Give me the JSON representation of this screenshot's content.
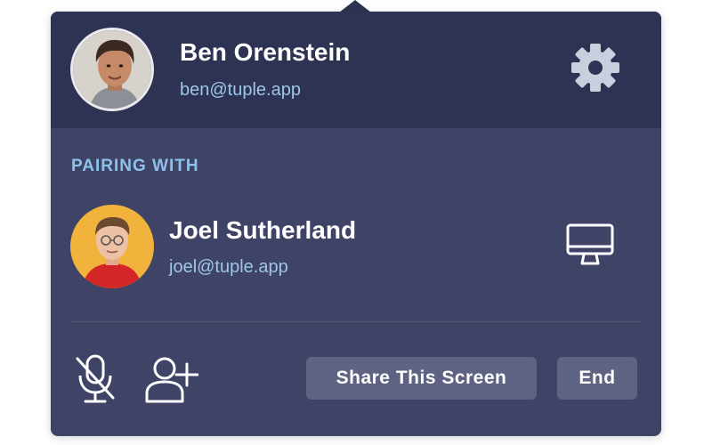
{
  "me": {
    "name": "Ben Orenstein",
    "email": "ben@tuple.app",
    "avatar_icon": "user-photo"
  },
  "settings": {
    "icon": "gear-icon"
  },
  "pairing": {
    "section_label": "PAIRING WITH",
    "peer": {
      "name": "Joel Sutherland",
      "email": "joel@tuple.app",
      "avatar_icon": "user-photo"
    },
    "screen_icon": "monitor-icon"
  },
  "controls": {
    "mic_icon": "microphone-muted-icon",
    "add_user_icon": "add-user-icon",
    "share_label": "Share This Screen",
    "end_label": "End"
  },
  "colors": {
    "header_bg": "#2f3353",
    "panel_bg": "#3f4366",
    "button_bg": "#5f6383",
    "accent_text": "#9ec6e8"
  }
}
